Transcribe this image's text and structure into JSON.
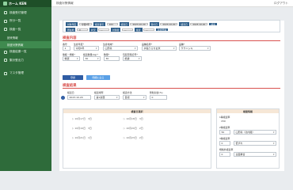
{
  "app": {
    "brand": "ホーム KEN",
    "header_title": "検査対策情報",
    "logout": "ログアウト"
  },
  "sidebar": {
    "items": [
      {
        "label": "検査受付管理",
        "icon": "clipboard-icon"
      },
      {
        "label": "所分一覧",
        "icon": "list-icon"
      },
      {
        "label": "検査一覧",
        "icon": "table-icon"
      },
      {
        "label": "読来情報",
        "icon": "doc-icon",
        "sub": true
      },
      {
        "label": "検査対策情報",
        "icon": "doc-icon",
        "sub": true,
        "active": true
      },
      {
        "label": "検査結果一覧",
        "icon": "chart-icon"
      },
      {
        "label": "集計登出力",
        "icon": "download-icon"
      },
      {
        "label": "マスタ管理",
        "icon": "gear-icon"
      }
    ]
  },
  "filter": {
    "r1": [
      {
        "label": "対象年度",
        "value": "令和5年"
      },
      {
        "label": "検査番号",
        "value": "164"
      },
      {
        "label": "検査日",
        "value": "2023.10.20"
      },
      {
        "label": "受付日",
        "value": "2023.10.20"
      },
      {
        "label": "検査日",
        "value": "2023.10.20"
      },
      {
        "label": "担当",
        "value": "担当A"
      }
    ],
    "r2": [
      {
        "label": "所在地",
        "value": "X"
      },
      {
        "label": "状況",
        "value": "—"
      },
      {
        "label": "対象者",
        "value": "—"
      },
      {
        "label": "検査",
        "value": "—"
      }
    ],
    "search_btn": "検索",
    "detail_btn": "新規登録"
  },
  "section1": {
    "title": "検査内容",
    "labels": {
      "no": "番号",
      "year": "生産年度*",
      "pref": "生産地域*",
      "breed": "品種名称*",
      "variety": "品種*",
      "grade": "等級・規格*",
      "weight": "検査数量(kg)*",
      "count": "数量*",
      "method": "包装形態記号*"
    },
    "values": {
      "no": "1",
      "year": "令和5年",
      "pref": "山形県",
      "breed": "水稲うるち玄米",
      "variety": "ササニシキ",
      "grade": "精選",
      "weight": "30",
      "count": "30",
      "method": "紙袋"
    },
    "buttons": {
      "register": "登録",
      "clear": "明細に戻る"
    }
  },
  "section2": {
    "title": "検査結果",
    "labels": {
      "date": "検査日",
      "place": "検査場所",
      "method": "検査方法",
      "rate": "整粒割合(%)"
    },
    "values": {
      "date": "2023.10.20",
      "place": "第1倉庫",
      "method": "目視",
      "rate": "0"
    }
  },
  "calendar": {
    "title": "検査日選択",
    "row1": [
      "10月17日",
      "火",
      "3日",
      "10月18日",
      "水",
      "3日"
    ],
    "row2": [
      "10月19日",
      "木",
      "3日",
      "10月20日",
      "金",
      "2日"
    ],
    "row3": [
      "10月21日",
      "土",
      "1日",
      "10月23日",
      "月",
      "2日"
    ]
  },
  "stats": {
    "title": "検査情報",
    "items": [
      {
        "label": "1等検査率",
        "value": "150"
      },
      {
        "label": "2等検査率",
        "value": "50"
      },
      {
        "label": "3等検査率",
        "value": "0"
      },
      {
        "label": "規格外検査率",
        "value": "0"
      }
    ],
    "selects": [
      "山形県（北内陸）",
      "低ずれ",
      "全面重合"
    ]
  },
  "colors": {
    "sidebar": "#2e6b3a",
    "accent": "#d9534f",
    "primary": "#2f5ca3"
  }
}
